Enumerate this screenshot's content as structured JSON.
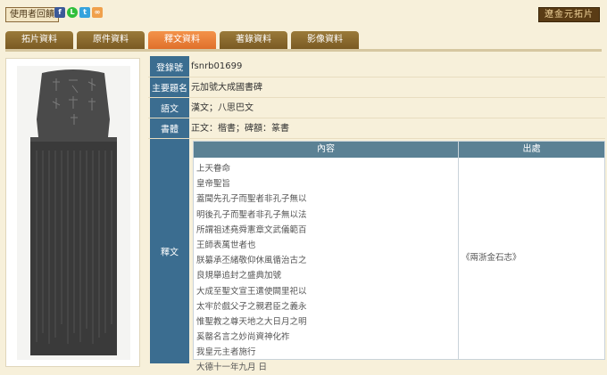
{
  "header": {
    "user_button": "使用者回饋",
    "share_icons": [
      "facebook-icon",
      "line-icon",
      "twitter-icon",
      "link-icon"
    ],
    "brand": "遼金元拓片"
  },
  "tabs": [
    {
      "label": "拓片資料",
      "active": false
    },
    {
      "label": "原件資料",
      "active": false
    },
    {
      "label": "釋文資料",
      "active": true
    },
    {
      "label": "著錄資料",
      "active": false
    },
    {
      "label": "影像資料",
      "active": false
    }
  ],
  "record": {
    "id_label": "登錄號",
    "id_value": "fsnrb01699",
    "title_label": "主要題名",
    "title_value": "元加號大成國書碑",
    "lang_label": "語文",
    "lang_value": "漢文；八思巴文",
    "script_label": "書體",
    "script_value": "正文：楷書；碑額：篆書",
    "text_label": "釋文"
  },
  "text_table": {
    "col_content": "內容",
    "col_source": "出處",
    "lines": [
      "上天眷命",
      "皇帝聖旨",
      "蓋聞先孔子而聖者非孔子無以",
      "明後孔子而聖者非孔子無以法",
      "所謂祖述堯舜憲章文武儀範百",
      "王師表萬世者也",
      "朕纂承丕緒敬仰休風循治古之",
      "良規舉追封之盛典加號",
      "大成至聖文宣王遣使闕里祀以",
      "太牢於戲父子之親君臣之義永",
      "惟聖教之尊天地之大日月之明",
      "奚罄名言之妙尚資神化祚",
      "我皇元主者施行",
      "大德十一年九月 日"
    ],
    "source": "《兩浙金石志》"
  },
  "colors": {
    "label_bg": "#3b6d90",
    "tab_bg": "#8a6a2f",
    "tab_active_bg": "#e87d36",
    "page_bg": "#f7f0da"
  }
}
